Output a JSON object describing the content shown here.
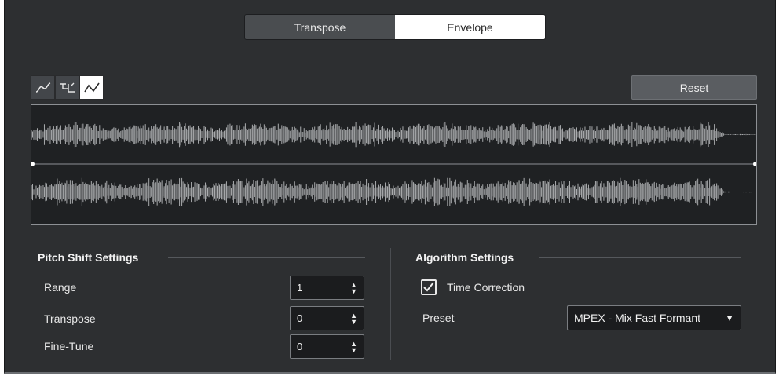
{
  "tabs": [
    {
      "label": "Transpose",
      "active": false
    },
    {
      "label": "Envelope",
      "active": true
    }
  ],
  "envelope_modes": [
    {
      "icon": "spline-curve-icon",
      "active": false
    },
    {
      "icon": "hold-curve-icon",
      "active": false
    },
    {
      "icon": "linear-curve-icon",
      "active": true
    }
  ],
  "reset_label": "Reset",
  "pitch_shift": {
    "title": "Pitch Shift Settings",
    "range": {
      "label": "Range",
      "value": "1"
    },
    "transpose": {
      "label": "Transpose",
      "value": "0"
    },
    "fine_tune": {
      "label": "Fine-Tune",
      "value": "0"
    }
  },
  "algorithm": {
    "title": "Algorithm Settings",
    "time_correction": {
      "label": "Time Correction",
      "checked": true
    },
    "preset": {
      "label": "Preset",
      "value": "MPEX - Mix Fast Formant"
    }
  },
  "colors": {
    "panel": "#2d2f31",
    "waveform": "#a9abad",
    "active_tab": "#ffffff"
  }
}
